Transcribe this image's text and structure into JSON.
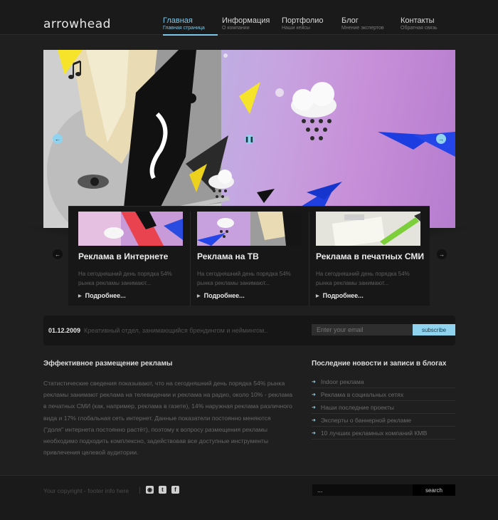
{
  "header": {
    "logo": "arrowhead",
    "nav": [
      {
        "label": "Главная",
        "sub": "Главная страница"
      },
      {
        "label": "Информация",
        "sub": "О компании"
      },
      {
        "label": "Портфолио",
        "sub": "Наши кейсы"
      },
      {
        "label": "Блог",
        "sub": "Мнение экспертов"
      },
      {
        "label": "Контакты",
        "sub": "Обратная связь"
      }
    ],
    "active_index": 0
  },
  "slider": {
    "prev_icon": "arrow-left-icon",
    "next_icon": "arrow-right-icon",
    "pause_icon": "pause-icon"
  },
  "features": [
    {
      "title": "Реклама в Интернете",
      "text": "На сегодняшний день порядка 54% рынка рекламы занимают...",
      "more": "Подробнее..."
    },
    {
      "title": "Реклама на ТВ",
      "text": "На сегодняшний день порядка 54% рынка рекламы занимают...",
      "more": "Подробнее..."
    },
    {
      "title": "Реклама в печатных СМИ",
      "text": "На сегодняшний день порядка 54% рынка рекламы занимают...",
      "more": "Подробнее..."
    }
  ],
  "datebar": {
    "date": "01.12.2009",
    "news": "Креативный отдел, занимающийся брендингом и неймингом..",
    "email_placeholder": "Enter your email",
    "subscribe_label": "subscribe"
  },
  "article": {
    "title": "Эффективное размещение рекламы",
    "body": "Статистические сведения показывают, что на сегодняшний день порядка 54% рынка рекламы занимают реклама на телевидении и реклама на радио, около 10% - реклама в печатных СМИ (как, например, реклама в газете), 14% наружная реклама различного вида и 17% глобальная сеть интернет. Данные показатели постоянно меняются (\"доля\" интернета постоянно растёт), поэтому к вопросу размещения рекламы необходимо подходить комплексно, задействовав все доступные инструменты привлечения целевой аудитории."
  },
  "news": {
    "title": "Последние новости и записи в блогах",
    "items": [
      "Indoor реклама",
      "Реклама в социальных сетях",
      "Наши последние проекты",
      "Эксперты о баннерной рекламе",
      "10 лучших рекламных компаний КМВ"
    ]
  },
  "footer": {
    "copyright": "Your copyright - footer info here",
    "separator": "|",
    "search_value": "...",
    "search_label": "search",
    "social": [
      {
        "icon": "rss-icon",
        "glyph": "◉"
      },
      {
        "icon": "twitter-icon",
        "glyph": "t"
      },
      {
        "icon": "facebook-icon",
        "glyph": "f"
      }
    ]
  },
  "colors": {
    "accent": "#8fd3ef",
    "background": "#1f1f1f"
  }
}
